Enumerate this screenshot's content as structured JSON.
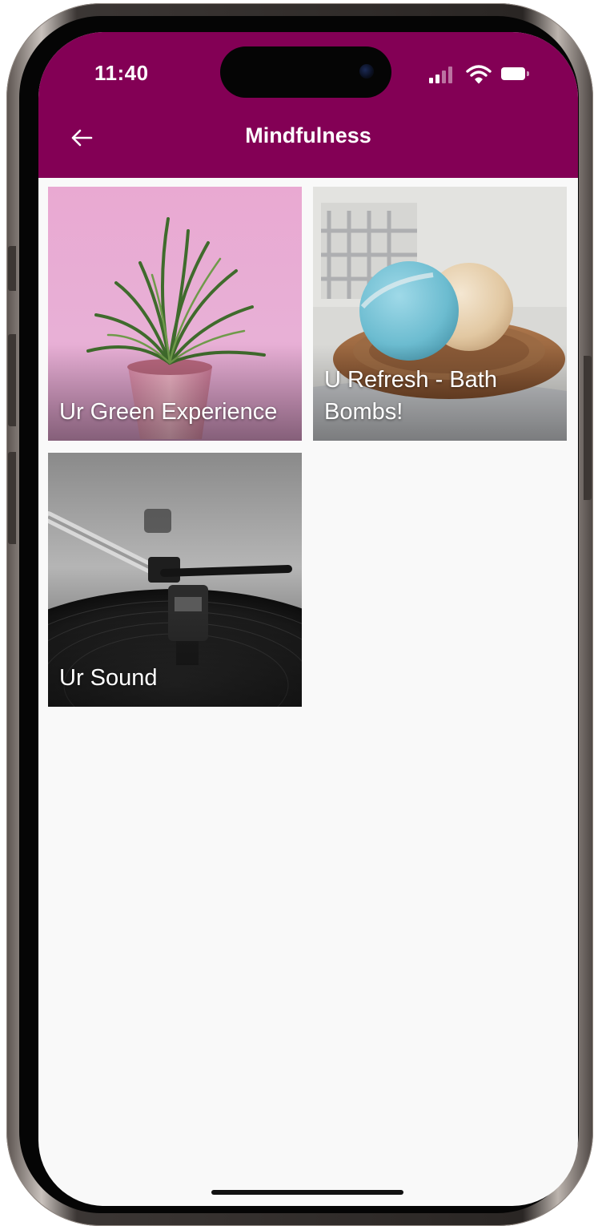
{
  "status_bar": {
    "time": "11:40"
  },
  "app_bar": {
    "title": "Mindfulness",
    "back_icon": "arrow-left-icon",
    "background_color": "#830055"
  },
  "tiles": [
    {
      "label": "Ur Green Experience",
      "image": "potted-air-plant"
    },
    {
      "label": "U Refresh - Bath Bombs!",
      "image": "bath-bombs-on-wooden-dish"
    },
    {
      "label": "Ur Sound",
      "image": "record-player-tonearm"
    }
  ]
}
